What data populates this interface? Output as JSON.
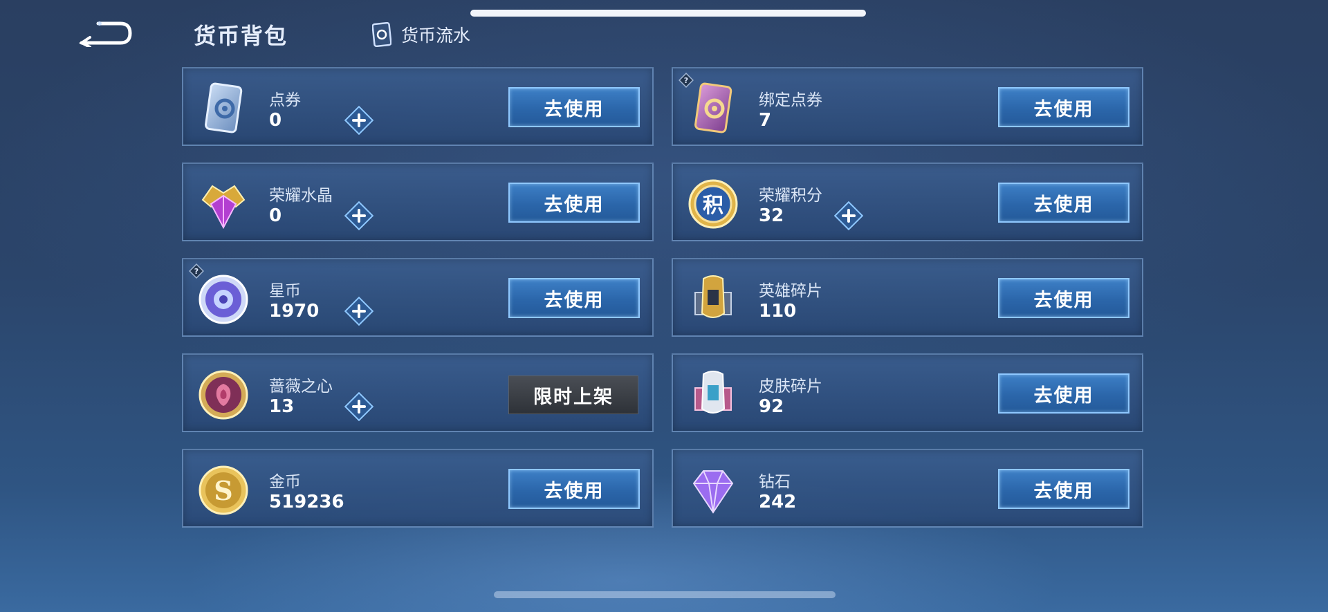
{
  "header": {
    "title": "货币背包",
    "flow_label": "货币流水"
  },
  "currencies": [
    {
      "name": "点券",
      "amount": "0",
      "has_plus": true,
      "action": "去使用",
      "icon": "coupon-ticket-icon"
    },
    {
      "name": "绑定点券",
      "amount": "7",
      "has_plus": false,
      "action": "去使用",
      "icon": "bound-coupon-icon",
      "help": "?"
    },
    {
      "name": "荣耀水晶",
      "amount": "0",
      "has_plus": true,
      "action": "去使用",
      "icon": "glory-crystal-icon"
    },
    {
      "name": "荣耀积分",
      "amount": "32",
      "has_plus": true,
      "action": "去使用",
      "icon": "glory-points-icon",
      "icon_text": "积"
    },
    {
      "name": "星币",
      "amount": "1970",
      "has_plus": true,
      "action": "去使用",
      "icon": "star-coin-icon",
      "help": "?"
    },
    {
      "name": "英雄碎片",
      "amount": "110",
      "has_plus": false,
      "action": "去使用",
      "icon": "hero-shard-icon"
    },
    {
      "name": "蔷薇之心",
      "amount": "13",
      "has_plus": true,
      "action": "限时上架",
      "icon": "rose-heart-icon"
    },
    {
      "name": "皮肤碎片",
      "amount": "92",
      "has_plus": false,
      "action": "去使用",
      "icon": "skin-shard-icon"
    },
    {
      "name": "金币",
      "amount": "519236",
      "has_plus": false,
      "action": "去使用",
      "icon": "gold-coin-icon",
      "icon_text": "S"
    },
    {
      "name": "钻石",
      "amount": "242",
      "has_plus": false,
      "action": "去使用",
      "icon": "diamond-icon"
    }
  ],
  "colors": {
    "button_blue": "#2b66aa",
    "button_border": "#8fc8ff",
    "limited_gray": "#3a3e44"
  }
}
